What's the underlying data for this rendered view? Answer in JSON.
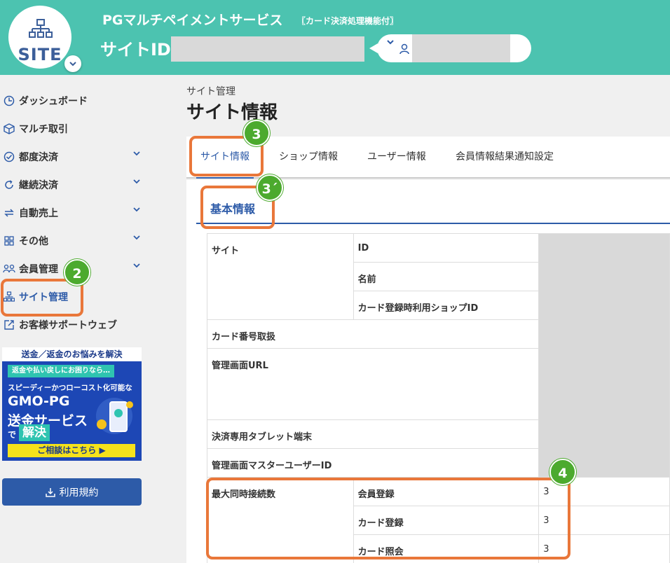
{
  "header": {
    "logo_text": "SITE",
    "app_title": "PGマルチペイメントサービス",
    "app_subtitle": "〖カード決済処理機能付〗",
    "site_id_label": "サイトID:"
  },
  "sidebar": {
    "items": [
      {
        "label": "ダッシュボード",
        "icon": "clock-icon",
        "has_chevron": false
      },
      {
        "label": "マルチ取引",
        "icon": "cube-icon",
        "has_chevron": false
      },
      {
        "label": "都度決済",
        "icon": "check-circle-icon",
        "has_chevron": true
      },
      {
        "label": "継続決済",
        "icon": "refresh-icon",
        "has_chevron": true
      },
      {
        "label": "自動売上",
        "icon": "swap-icon",
        "has_chevron": true
      },
      {
        "label": "その他",
        "icon": "grid-icon",
        "has_chevron": true
      },
      {
        "label": "会員管理",
        "icon": "users-icon",
        "has_chevron": true
      },
      {
        "label": "サイト管理",
        "icon": "sitemap-icon",
        "has_chevron": false,
        "active": true
      },
      {
        "label": "お客様サポートウェブ",
        "icon": "external-link-icon",
        "has_chevron": false
      }
    ],
    "banner": {
      "top": "送金／返金のお悩みを解決",
      "tag": "返金や払い戻しにお困りなら…",
      "sub": "スピーディーかつローコスト化可能な",
      "big1": "GMO-PG",
      "big2": "送金サービス",
      "de": "で",
      "kai": "解決",
      "cta": "ご相談はこちら ▶"
    },
    "terms_button": "利用規約"
  },
  "main": {
    "breadcrumb": "サイト管理",
    "title": "サイト情報",
    "tabs": [
      "サイト情報",
      "ショップ情報",
      "ユーザー情報",
      "会員情報結果通知設定"
    ],
    "section_title": "基本情報",
    "rows": {
      "site": "サイト",
      "id": "ID",
      "name": "名前",
      "card_shop_id": "カード登録時利用ショップID",
      "card_number": "カード番号取扱",
      "admin_url": "管理画面URL",
      "tablet": "決済専用タブレット端末",
      "master_user": "管理画面マスターユーザーID",
      "max_conn": "最大同時接続数",
      "member_reg": "会員登録",
      "member_reg_val": "3",
      "card_reg": "カード登録",
      "card_reg_val": "3",
      "card_ref": "カード照会",
      "card_ref_val": "3"
    }
  },
  "annotations": {
    "badge_2": "2",
    "badge_3": "3",
    "badge_3p": "3´",
    "badge_4": "4",
    "highlight_color": "#e9773a",
    "badge_color": "#4caa2e"
  }
}
